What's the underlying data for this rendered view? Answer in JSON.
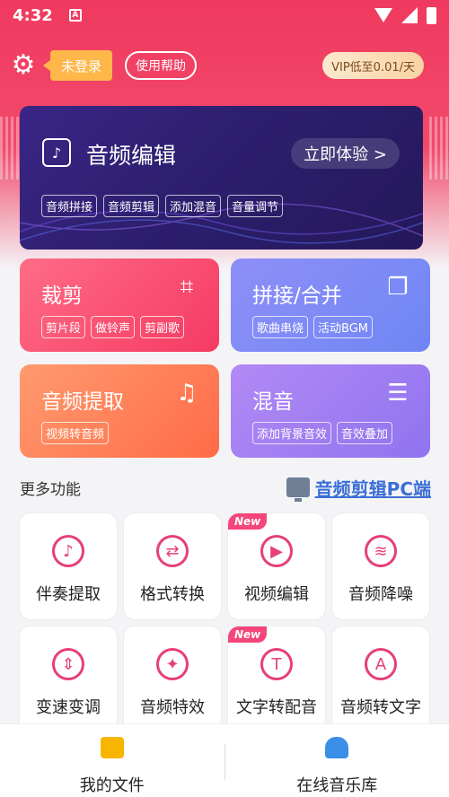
{
  "status_bar": {
    "time": "4:32",
    "notif": "A"
  },
  "top_bar": {
    "login_label": "未登录",
    "help_label": "使用帮助",
    "vip_label": "VIP低至0.01/天"
  },
  "hero": {
    "title": "音频编辑",
    "cta": "立即体验 >",
    "tags": [
      "音频拼接",
      "音频剪辑",
      "添加混音",
      "音量调节"
    ]
  },
  "cards": {
    "crop": {
      "title": "裁剪",
      "tags": [
        "剪片段",
        "做铃声",
        "剪副歌"
      ]
    },
    "concat": {
      "title": "拼接/合并",
      "tags": [
        "歌曲串烧",
        "活动BGM"
      ]
    },
    "extract": {
      "title": "音频提取",
      "tags": [
        "视频转音频"
      ]
    },
    "mix": {
      "title": "混音",
      "tags": [
        "添加背景音效",
        "音效叠加"
      ]
    }
  },
  "more": {
    "label": "更多功能",
    "pc_link": "音频剪辑PC端"
  },
  "tools": [
    {
      "label": "伴奏提取",
      "icon": "music-note-icon",
      "new": ""
    },
    {
      "label": "格式转换",
      "icon": "convert-icon",
      "new": ""
    },
    {
      "label": "视频编辑",
      "icon": "video-icon",
      "new": "New"
    },
    {
      "label": "音频降噪",
      "icon": "waveform-icon",
      "new": ""
    },
    {
      "label": "变速变调",
      "icon": "speed-icon",
      "new": ""
    },
    {
      "label": "音频特效",
      "icon": "magic-wand-icon",
      "new": ""
    },
    {
      "label": "文字转配音",
      "icon": "text-to-speech-icon",
      "new": "New"
    },
    {
      "label": "音频转文字",
      "icon": "speech-to-text-icon",
      "new": ""
    }
  ],
  "bottom_nav": {
    "files": "我的文件",
    "library": "在线音乐库"
  },
  "colors": {
    "primary": "#f0395f",
    "accent": "#e63f7a",
    "link": "#3b6fd6"
  }
}
